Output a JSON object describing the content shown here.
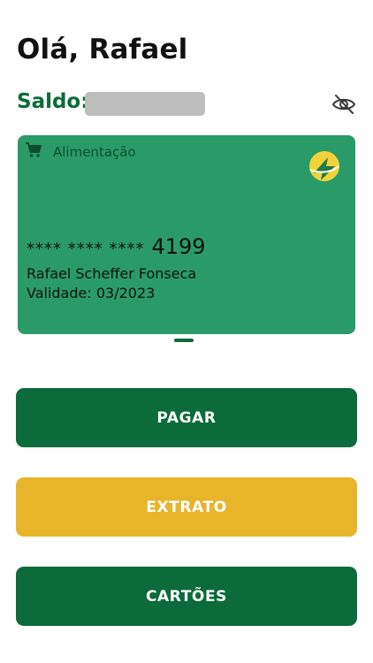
{
  "header": {
    "greeting": "Olá, Rafael"
  },
  "balance": {
    "label": "Saldo:",
    "visibility_icon": "eye-off-icon"
  },
  "card": {
    "type_icon": "cart-icon",
    "type_label": "Alimentação",
    "brand_logo": "brand-logo-icon",
    "number_mask": "**** **** ****",
    "number_last4": "4199",
    "holder_name": "Rafael Scheffer Fonseca",
    "validity": "Validade: 03/2023",
    "color": "#2a9b68"
  },
  "actions": {
    "pay_label": "PAGAR",
    "statement_label": "EXTRATO",
    "cards_label": "CARTÕES"
  },
  "colors": {
    "primary_green": "#0b6b3a",
    "accent_yellow": "#e8b52a",
    "card_green": "#2a9b68",
    "mask_gray": "#bdbdbd"
  }
}
